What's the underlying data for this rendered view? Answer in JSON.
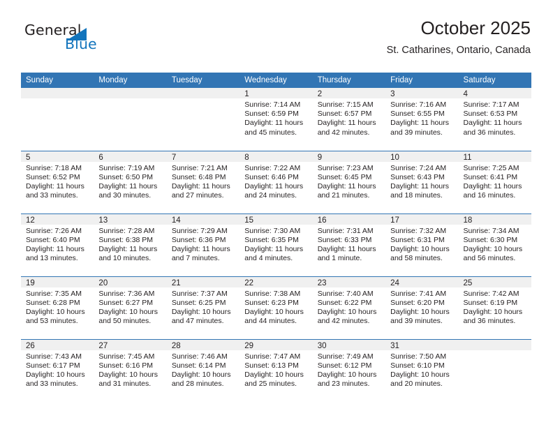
{
  "logo": {
    "word1": "General",
    "word2": "Blue",
    "triangle_color": "#1274bc"
  },
  "header": {
    "title": "October 2025",
    "subtitle": "St. Catharines, Ontario, Canada",
    "accent_color": "#3275b4",
    "daynum_band_color": "#f0f0f0"
  },
  "weekday_headers": [
    "Sunday",
    "Monday",
    "Tuesday",
    "Wednesday",
    "Thursday",
    "Friday",
    "Saturday"
  ],
  "labels": {
    "sunrise_prefix": "Sunrise:",
    "sunset_prefix": "Sunset:",
    "daylight_prefix": "Daylight:"
  },
  "weeks": [
    [
      {
        "day": "",
        "empty": true
      },
      {
        "day": "",
        "empty": true
      },
      {
        "day": "",
        "empty": true
      },
      {
        "day": "1",
        "sunrise": "Sunrise: 7:14 AM",
        "sunset": "Sunset: 6:59 PM",
        "daylight_l1": "Daylight: 11 hours",
        "daylight_l2": "and 45 minutes."
      },
      {
        "day": "2",
        "sunrise": "Sunrise: 7:15 AM",
        "sunset": "Sunset: 6:57 PM",
        "daylight_l1": "Daylight: 11 hours",
        "daylight_l2": "and 42 minutes."
      },
      {
        "day": "3",
        "sunrise": "Sunrise: 7:16 AM",
        "sunset": "Sunset: 6:55 PM",
        "daylight_l1": "Daylight: 11 hours",
        "daylight_l2": "and 39 minutes."
      },
      {
        "day": "4",
        "sunrise": "Sunrise: 7:17 AM",
        "sunset": "Sunset: 6:53 PM",
        "daylight_l1": "Daylight: 11 hours",
        "daylight_l2": "and 36 minutes."
      }
    ],
    [
      {
        "day": "5",
        "sunrise": "Sunrise: 7:18 AM",
        "sunset": "Sunset: 6:52 PM",
        "daylight_l1": "Daylight: 11 hours",
        "daylight_l2": "and 33 minutes."
      },
      {
        "day": "6",
        "sunrise": "Sunrise: 7:19 AM",
        "sunset": "Sunset: 6:50 PM",
        "daylight_l1": "Daylight: 11 hours",
        "daylight_l2": "and 30 minutes."
      },
      {
        "day": "7",
        "sunrise": "Sunrise: 7:21 AM",
        "sunset": "Sunset: 6:48 PM",
        "daylight_l1": "Daylight: 11 hours",
        "daylight_l2": "and 27 minutes."
      },
      {
        "day": "8",
        "sunrise": "Sunrise: 7:22 AM",
        "sunset": "Sunset: 6:46 PM",
        "daylight_l1": "Daylight: 11 hours",
        "daylight_l2": "and 24 minutes."
      },
      {
        "day": "9",
        "sunrise": "Sunrise: 7:23 AM",
        "sunset": "Sunset: 6:45 PM",
        "daylight_l1": "Daylight: 11 hours",
        "daylight_l2": "and 21 minutes."
      },
      {
        "day": "10",
        "sunrise": "Sunrise: 7:24 AM",
        "sunset": "Sunset: 6:43 PM",
        "daylight_l1": "Daylight: 11 hours",
        "daylight_l2": "and 18 minutes."
      },
      {
        "day": "11",
        "sunrise": "Sunrise: 7:25 AM",
        "sunset": "Sunset: 6:41 PM",
        "daylight_l1": "Daylight: 11 hours",
        "daylight_l2": "and 16 minutes."
      }
    ],
    [
      {
        "day": "12",
        "sunrise": "Sunrise: 7:26 AM",
        "sunset": "Sunset: 6:40 PM",
        "daylight_l1": "Daylight: 11 hours",
        "daylight_l2": "and 13 minutes."
      },
      {
        "day": "13",
        "sunrise": "Sunrise: 7:28 AM",
        "sunset": "Sunset: 6:38 PM",
        "daylight_l1": "Daylight: 11 hours",
        "daylight_l2": "and 10 minutes."
      },
      {
        "day": "14",
        "sunrise": "Sunrise: 7:29 AM",
        "sunset": "Sunset: 6:36 PM",
        "daylight_l1": "Daylight: 11 hours",
        "daylight_l2": "and 7 minutes."
      },
      {
        "day": "15",
        "sunrise": "Sunrise: 7:30 AM",
        "sunset": "Sunset: 6:35 PM",
        "daylight_l1": "Daylight: 11 hours",
        "daylight_l2": "and 4 minutes."
      },
      {
        "day": "16",
        "sunrise": "Sunrise: 7:31 AM",
        "sunset": "Sunset: 6:33 PM",
        "daylight_l1": "Daylight: 11 hours",
        "daylight_l2": "and 1 minute."
      },
      {
        "day": "17",
        "sunrise": "Sunrise: 7:32 AM",
        "sunset": "Sunset: 6:31 PM",
        "daylight_l1": "Daylight: 10 hours",
        "daylight_l2": "and 58 minutes."
      },
      {
        "day": "18",
        "sunrise": "Sunrise: 7:34 AM",
        "sunset": "Sunset: 6:30 PM",
        "daylight_l1": "Daylight: 10 hours",
        "daylight_l2": "and 56 minutes."
      }
    ],
    [
      {
        "day": "19",
        "sunrise": "Sunrise: 7:35 AM",
        "sunset": "Sunset: 6:28 PM",
        "daylight_l1": "Daylight: 10 hours",
        "daylight_l2": "and 53 minutes."
      },
      {
        "day": "20",
        "sunrise": "Sunrise: 7:36 AM",
        "sunset": "Sunset: 6:27 PM",
        "daylight_l1": "Daylight: 10 hours",
        "daylight_l2": "and 50 minutes."
      },
      {
        "day": "21",
        "sunrise": "Sunrise: 7:37 AM",
        "sunset": "Sunset: 6:25 PM",
        "daylight_l1": "Daylight: 10 hours",
        "daylight_l2": "and 47 minutes."
      },
      {
        "day": "22",
        "sunrise": "Sunrise: 7:38 AM",
        "sunset": "Sunset: 6:23 PM",
        "daylight_l1": "Daylight: 10 hours",
        "daylight_l2": "and 44 minutes."
      },
      {
        "day": "23",
        "sunrise": "Sunrise: 7:40 AM",
        "sunset": "Sunset: 6:22 PM",
        "daylight_l1": "Daylight: 10 hours",
        "daylight_l2": "and 42 minutes."
      },
      {
        "day": "24",
        "sunrise": "Sunrise: 7:41 AM",
        "sunset": "Sunset: 6:20 PM",
        "daylight_l1": "Daylight: 10 hours",
        "daylight_l2": "and 39 minutes."
      },
      {
        "day": "25",
        "sunrise": "Sunrise: 7:42 AM",
        "sunset": "Sunset: 6:19 PM",
        "daylight_l1": "Daylight: 10 hours",
        "daylight_l2": "and 36 minutes."
      }
    ],
    [
      {
        "day": "26",
        "sunrise": "Sunrise: 7:43 AM",
        "sunset": "Sunset: 6:17 PM",
        "daylight_l1": "Daylight: 10 hours",
        "daylight_l2": "and 33 minutes."
      },
      {
        "day": "27",
        "sunrise": "Sunrise: 7:45 AM",
        "sunset": "Sunset: 6:16 PM",
        "daylight_l1": "Daylight: 10 hours",
        "daylight_l2": "and 31 minutes."
      },
      {
        "day": "28",
        "sunrise": "Sunrise: 7:46 AM",
        "sunset": "Sunset: 6:14 PM",
        "daylight_l1": "Daylight: 10 hours",
        "daylight_l2": "and 28 minutes."
      },
      {
        "day": "29",
        "sunrise": "Sunrise: 7:47 AM",
        "sunset": "Sunset: 6:13 PM",
        "daylight_l1": "Daylight: 10 hours",
        "daylight_l2": "and 25 minutes."
      },
      {
        "day": "30",
        "sunrise": "Sunrise: 7:49 AM",
        "sunset": "Sunset: 6:12 PM",
        "daylight_l1": "Daylight: 10 hours",
        "daylight_l2": "and 23 minutes."
      },
      {
        "day": "31",
        "sunrise": "Sunrise: 7:50 AM",
        "sunset": "Sunset: 6:10 PM",
        "daylight_l1": "Daylight: 10 hours",
        "daylight_l2": "and 20 minutes."
      },
      {
        "day": "",
        "empty": true
      }
    ]
  ]
}
